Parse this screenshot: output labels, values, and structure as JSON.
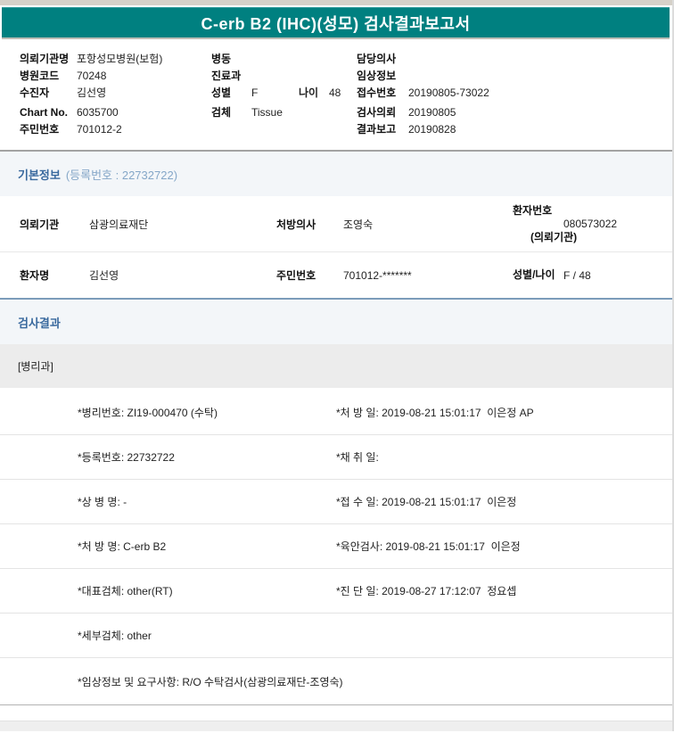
{
  "title": "C-erb B2 (IHC)(성모) 검사결과보고서",
  "colors": {
    "title_bar_bg": "#008080",
    "title_text": "#ffffff",
    "section_title_text": "#39699e",
    "basic_border": "#a3a3a3",
    "results_border": "#7c9cba"
  },
  "header_info": {
    "col1": [
      {
        "label": "의뢰기관명",
        "value": "포항성모병원(보험)"
      },
      {
        "label": "병원코드",
        "value": "70248"
      },
      {
        "label": "수진자",
        "value": "김선영"
      },
      {
        "label": "Chart No.",
        "value": "6035700"
      },
      {
        "label": "주민번호",
        "value": "701012-2"
      }
    ],
    "col2": [
      {
        "label": "병동",
        "value": ""
      },
      {
        "label": "진료과",
        "value": ""
      },
      {
        "label": "성별",
        "value": "F",
        "label2": "나이",
        "value2": "48"
      },
      {
        "label": "검체",
        "value": "Tissue"
      }
    ],
    "col3": [
      {
        "label": "담당의사",
        "value": ""
      },
      {
        "label": "임상정보",
        "value": ""
      },
      {
        "label": "접수번호",
        "value": "20190805-73022"
      },
      {
        "label": "검사의뢰",
        "value": "20190805"
      },
      {
        "label": "결과보고",
        "value": "20190828"
      }
    ]
  },
  "basic_info": {
    "section_title": "기본정보",
    "section_subtitle": "(등록번호 : 22732722)",
    "row1": {
      "c1_label": "의뢰기관",
      "c1_value": "삼광의료재단",
      "c2_label": "처방의사",
      "c2_value": "조영숙",
      "c3_label_line1": "환자번호",
      "c3_label_line2": "(의뢰기관)",
      "c3_value": "080573022"
    },
    "row2": {
      "c1_label": "환자명",
      "c1_value": "김선영",
      "c2_label": "주민번호",
      "c2_value": "701012-*******",
      "c3_label": "성별/나이",
      "c3_value": "F / 48"
    }
  },
  "results": {
    "section_title": "검사결과",
    "department": "[병리과]",
    "rows": [
      {
        "left": "*병리번호: ZI19-000470 (수탁)",
        "right": "*처 방 일: 2019-08-21 15:01:17  이은정 AP"
      },
      {
        "left": "*등록번호: 22732722",
        "right": "*채 취 일:"
      },
      {
        "left": "*상 병 명: -",
        "right": "*접 수 일: 2019-08-21 15:01:17  이은정"
      },
      {
        "left": "*처 방 명: C-erb B2",
        "right": "*육안검사: 2019-08-21 15:01:17  이은정"
      },
      {
        "left": "*대표검체: other(RT)",
        "right": "*진 단 일: 2019-08-27 17:12:07  정요셉"
      },
      {
        "left": "*세부검체: other",
        "right": ""
      },
      {
        "left": "*임상정보 및 요구사항: R/O 수탁검사(삼광의료재단-조영숙)",
        "right": ""
      }
    ]
  }
}
